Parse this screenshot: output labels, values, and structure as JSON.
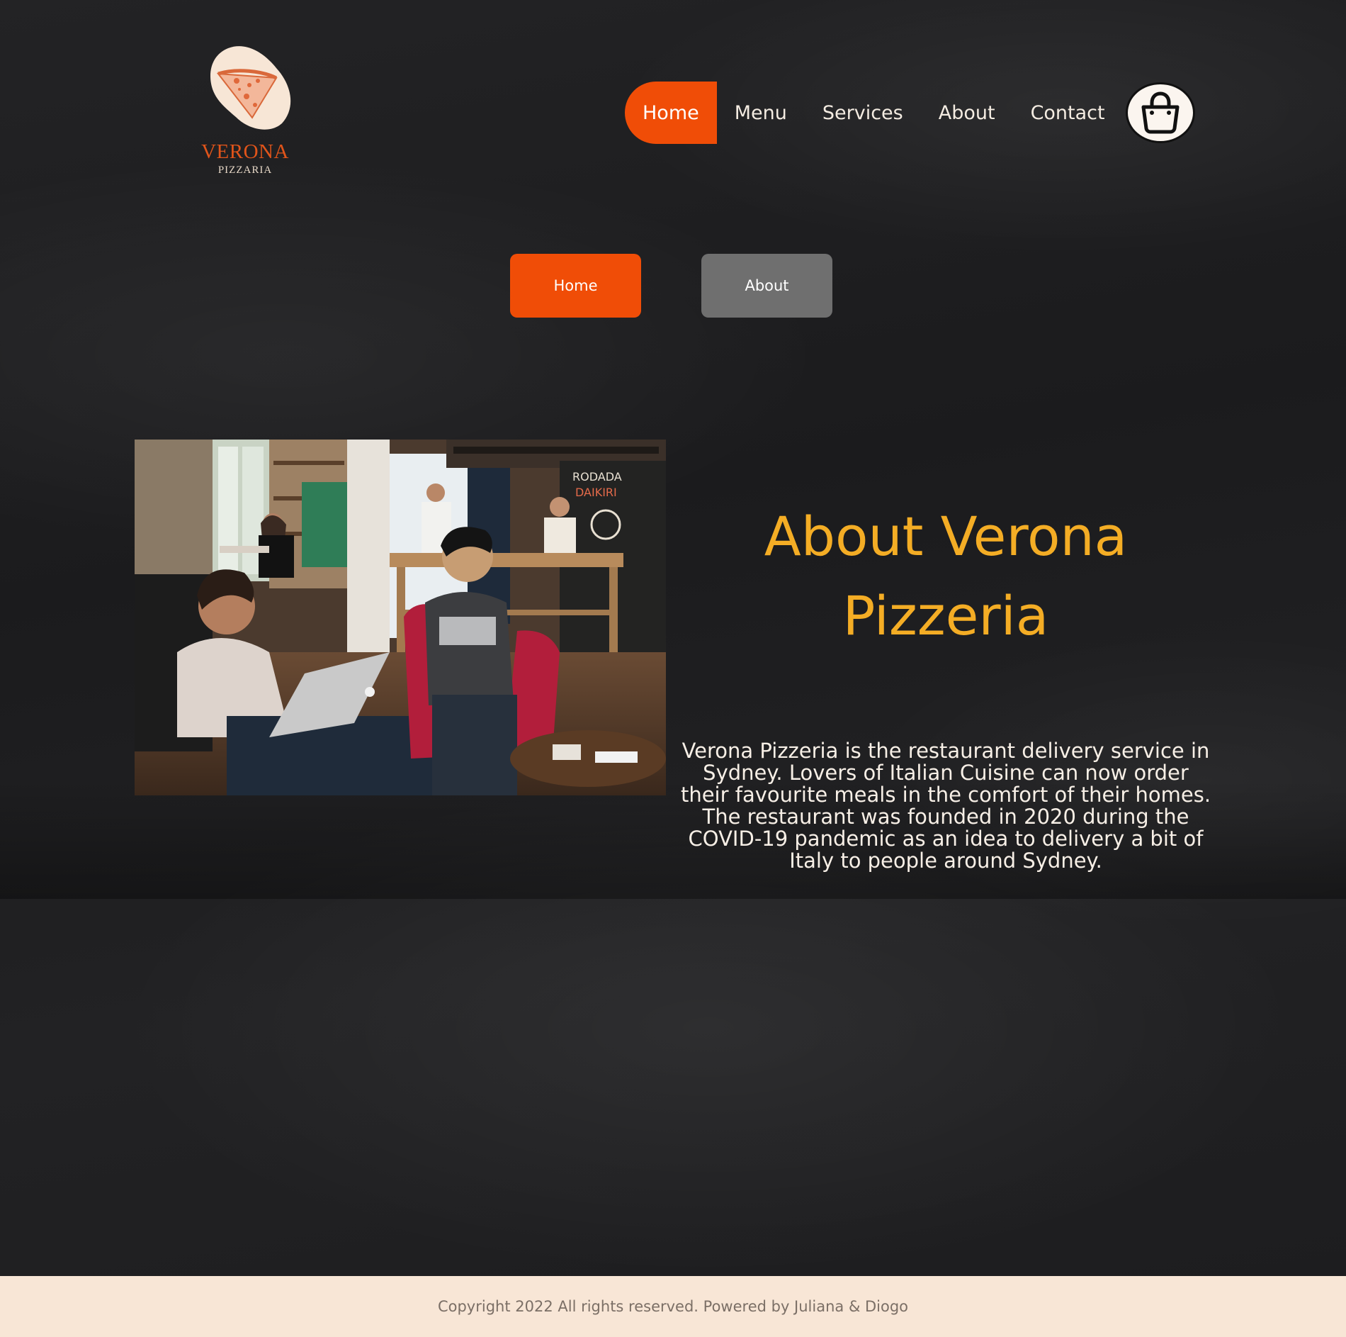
{
  "logo": {
    "name": "VERONA",
    "subtitle": "PIZZARIA"
  },
  "nav": {
    "items": [
      {
        "label": "Home",
        "active": true
      },
      {
        "label": "Menu",
        "active": false
      },
      {
        "label": "Services",
        "active": false
      },
      {
        "label": "About",
        "active": false
      },
      {
        "label": "Contact",
        "active": false
      }
    ],
    "cart_icon": "shopping-bag-icon"
  },
  "breadcrumb": {
    "home_label": "Home",
    "about_label": "About"
  },
  "about": {
    "title_line1": "About Verona",
    "title_line2": "Pizzeria",
    "text": "Verona Pizzeria is the restaurant delivery service in Sydney. Lovers of Italian Cuisine can now order their favourite meals in the comfort of their homes. The restaurant was founded in 2020 during the COVID-19 pandemic as an idea to delivery a bit of Italy to people around Sydney."
  },
  "footer": {
    "copyright": "Copyright 2022 All rights reserved. Powered by Juliana & Diogo"
  },
  "colors": {
    "accent": "#f04d07",
    "title": "#f4ad25",
    "footer_bg": "#f8e6d6",
    "button_grey": "#6f6f6f"
  }
}
